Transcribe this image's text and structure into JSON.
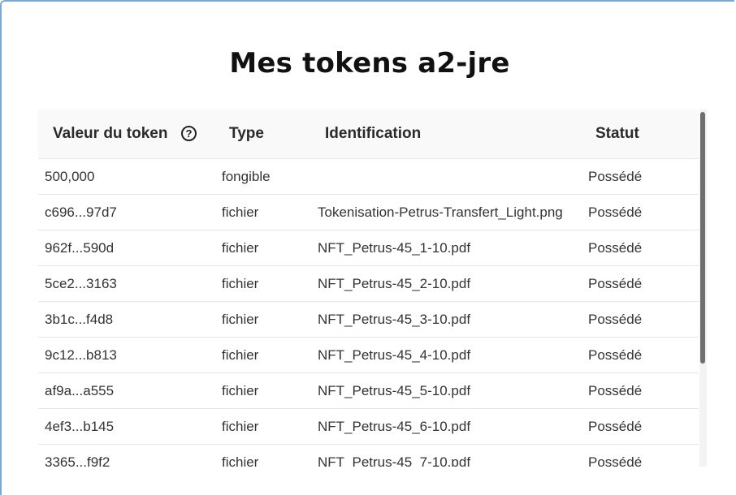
{
  "title": "Mes tokens a2-jre",
  "table": {
    "headers": {
      "value": "Valeur du token",
      "help_icon": "?",
      "type": "Type",
      "identification": "Identification",
      "status": "Statut"
    },
    "rows": [
      {
        "value": "500,000",
        "type": "fongible",
        "identification": "",
        "status": "Possédé"
      },
      {
        "value": "c696...97d7",
        "type": "fichier",
        "identification": "Tokenisation-Petrus-Transfert_Light.png",
        "status": "Possédé"
      },
      {
        "value": "962f...590d",
        "type": "fichier",
        "identification": "NFT_Petrus-45_1-10.pdf",
        "status": "Possédé"
      },
      {
        "value": "5ce2...3163",
        "type": "fichier",
        "identification": "NFT_Petrus-45_2-10.pdf",
        "status": "Possédé"
      },
      {
        "value": "3b1c...f4d8",
        "type": "fichier",
        "identification": "NFT_Petrus-45_3-10.pdf",
        "status": "Possédé"
      },
      {
        "value": "9c12...b813",
        "type": "fichier",
        "identification": "NFT_Petrus-45_4-10.pdf",
        "status": "Possédé"
      },
      {
        "value": "af9a...a555",
        "type": "fichier",
        "identification": "NFT_Petrus-45_5-10.pdf",
        "status": "Possédé"
      },
      {
        "value": "4ef3...b145",
        "type": "fichier",
        "identification": "NFT_Petrus-45_6-10.pdf",
        "status": "Possédé"
      },
      {
        "value": "3365...f9f2",
        "type": "fichier",
        "identification": "NFT_Petrus-45_7-10.pdf",
        "status": "Possédé"
      }
    ]
  }
}
